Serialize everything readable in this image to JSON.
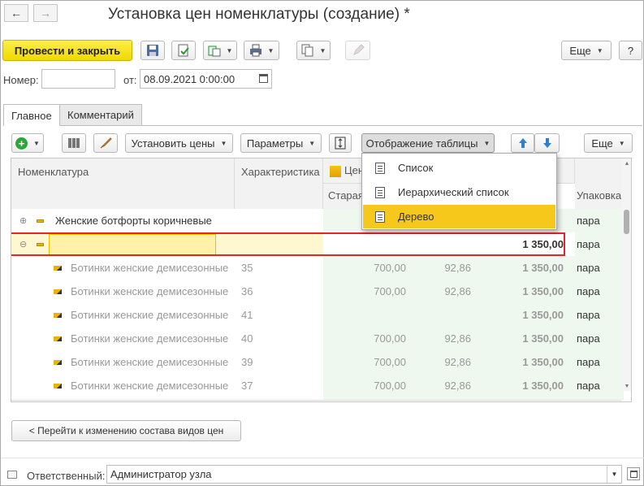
{
  "header": {
    "back_icon": "←",
    "forward_icon": "→",
    "title": "Установка цен номенклатуры (создание) *"
  },
  "toolbar": {
    "post_close_label": "Провести и закрыть",
    "more_label": "Еще",
    "help_label": "?"
  },
  "form": {
    "number_label": "Номер:",
    "number_value": "",
    "date_label": "от:",
    "date_value": "08.09.2021  0:00:00"
  },
  "tabs": [
    {
      "label": "Главное"
    },
    {
      "label": "Комментарий"
    }
  ],
  "table_toolbar": {
    "set_prices_label": "Установить цены",
    "parameters_label": "Параметры",
    "table_display_label": "Отображение таблицы",
    "more_label": "Еще"
  },
  "display_menu": {
    "items": [
      {
        "label": "Список"
      },
      {
        "label": "Иерархический список"
      },
      {
        "label": "Дерево"
      }
    ]
  },
  "table": {
    "columns": {
      "nomenclature": "Номенклатура",
      "characteristic": "Характеристика",
      "price_group": "Цены",
      "old": "Старая",
      "packaging": "Упаковка"
    },
    "rows": [
      {
        "name": "Женские ботфорты коричневые",
        "char": "",
        "old": "",
        "c3": "",
        "price": "",
        "pack": "пара",
        "level": 0,
        "expanded": false
      },
      {
        "name": "Ботинки женские демисезонные",
        "char": "",
        "old": "",
        "c3": "",
        "price": "1 350,00",
        "pack": "пара",
        "level": 0,
        "expanded": true
      },
      {
        "name": "Ботинки женские демисезонные",
        "char": "35",
        "old": "700,00",
        "c3": "92,86",
        "price": "1 350,00",
        "pack": "пара",
        "level": 1
      },
      {
        "name": "Ботинки женские демисезонные",
        "char": "36",
        "old": "700,00",
        "c3": "92,86",
        "price": "1 350,00",
        "pack": "пара",
        "level": 1
      },
      {
        "name": "Ботинки женские демисезонные",
        "char": "41",
        "old": "",
        "c3": "",
        "price": "1 350,00",
        "pack": "пара",
        "level": 1
      },
      {
        "name": "Ботинки женские демисезонные",
        "char": "40",
        "old": "700,00",
        "c3": "92,86",
        "price": "1 350,00",
        "pack": "пара",
        "level": 1
      },
      {
        "name": "Ботинки женские демисезонные",
        "char": "39",
        "old": "700,00",
        "c3": "92,86",
        "price": "1 350,00",
        "pack": "пара",
        "level": 1
      },
      {
        "name": "Ботинки женские демисезонные",
        "char": "37",
        "old": "700,00",
        "c3": "92,86",
        "price": "1 350,00",
        "pack": "пара",
        "level": 1
      }
    ]
  },
  "bottom": {
    "goto_label": "< Перейти к изменению состава видов цен",
    "responsible_label": "Ответственный:",
    "responsible_value": "Администратор узла"
  },
  "colors": {
    "accent_yellow": "#f5e31a",
    "selection_red": "#e0262b",
    "highlight_yellow": "#fff6b3",
    "menu_selected": "#f7c81c"
  }
}
